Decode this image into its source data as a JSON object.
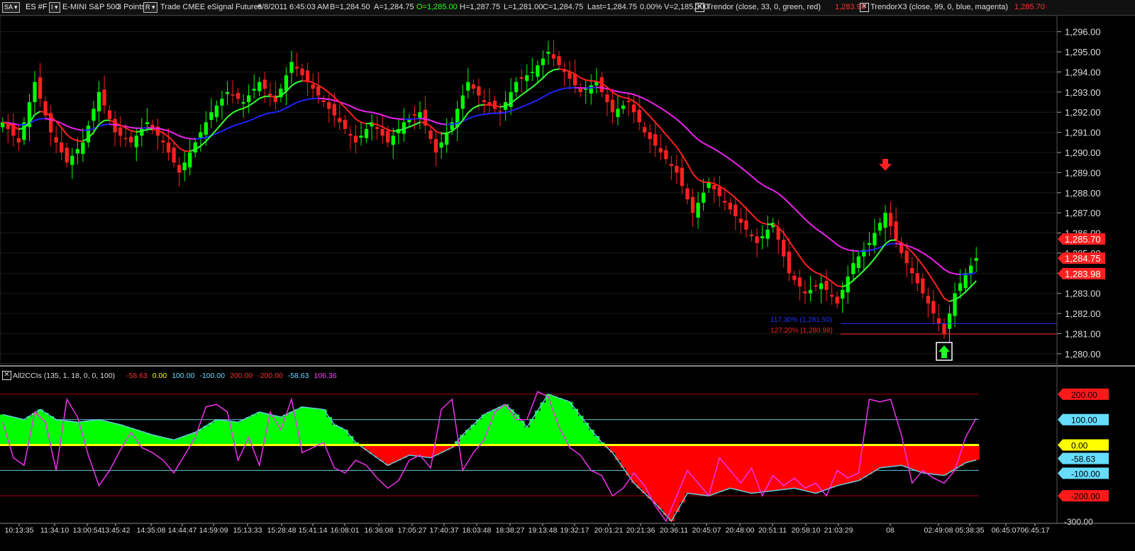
{
  "header": {
    "chart_button": "SA",
    "symbol": "ES #F",
    "interval_button": "I",
    "description": "E-MINI S&P 500",
    "points": "3 Points",
    "r_button": "R",
    "feed": "Trade  CMEE  eSignal  Futures",
    "date": "6/8/2011",
    "time": "6:45:03 AM",
    "bid": "B=1,284.50",
    "ask": "A=1,284.75",
    "open": "O=1,285.00",
    "high": "H=1,287.75",
    "low": "L=1,281.00",
    "close": "C=1,284.75",
    "last": "Last=1,284.75",
    "change": "0.00%",
    "volume": "V=2,185,300",
    "study1": "Trendor (close, 33, 0, green, red)",
    "study1_value": "1,283.98",
    "study2": "TrendorX3 (close, 99, 0, blue, magenta)",
    "study2_value": "1,285.70"
  },
  "lower_header": {
    "study": "All2CCIs (135, 1, 18, 0, 0, 100)",
    "values": [
      "-58.63",
      "0.00",
      "100.00",
      "-100.00",
      "200.00",
      "-200.00",
      "-58.63",
      "106.36"
    ],
    "value_colors": [
      "#ff3030",
      "#ffff00",
      "#66ddff",
      "#66ddff",
      "#ff3030",
      "#ff3030",
      "#66ddff",
      "#ff44ff"
    ]
  },
  "price_labels": {
    "p1": {
      "text": "1,285.70",
      "value": 1285.7,
      "color": "#ff2020"
    },
    "p2": {
      "text": "1,284.75",
      "value": 1284.75,
      "color": "#ff2020"
    },
    "p3": {
      "text": "1,283.98",
      "value": 1283.98,
      "color": "#ff2020"
    }
  },
  "fib_levels": [
    {
      "label": "117.30% (1,281.50)",
      "value": 1281.5,
      "color": "#2233ff"
    },
    {
      "label": "127.20% (1,280.98)",
      "value": 1280.98,
      "color": "#ff2020"
    }
  ],
  "signals": [
    {
      "name": "sell-arrow",
      "direction": "down",
      "bar": 165,
      "color": "#ff2020"
    },
    {
      "name": "buy-arrow",
      "direction": "up",
      "bar": 176,
      "color": "#22ff22"
    }
  ],
  "osc_labels": [
    {
      "text": "200.00",
      "value": 200,
      "bg": "#ff1a1a",
      "fg": "#000"
    },
    {
      "text": "100.00",
      "value": 100,
      "bg": "#66ddff",
      "fg": "#000"
    },
    {
      "text": "0.00",
      "value": 0,
      "bg": "#ffff00",
      "fg": "#000"
    },
    {
      "text": "-58.63",
      "value": -58.63,
      "bg": "#66ddff",
      "fg": "#000"
    },
    {
      "text": "-100.00",
      "value": -100,
      "bg": "#66ddff",
      "fg": "#000"
    },
    {
      "text": "-200.00",
      "value": -200,
      "bg": "#ff1a1a",
      "fg": "#000"
    }
  ],
  "colors": {
    "background": "#000000",
    "up_candle": "#00ff00",
    "down_candle": "#ff2020",
    "trendor_fast_up": "#33ff33",
    "trendor_fast_down": "#ff2020",
    "trendor_slow_up": "#2222ff",
    "trendor_slow_down": "#ee22ee",
    "cci_positive": "#00ff00",
    "cci_negative": "#ff0000",
    "cci_line": "#ee33ee",
    "cci_outline": "#66ccdd",
    "zero_line": "#ffff00"
  },
  "chart_data": [
    {
      "type": "candlestick",
      "title": "E-MINI S&P 500 (ES #F) 3 Points",
      "ylim": [
        1279.5,
        1296.8
      ],
      "y_ticks": [
        1280,
        1281,
        1282,
        1283,
        1284,
        1285,
        1286,
        1287,
        1288,
        1289,
        1290,
        1291,
        1292,
        1293,
        1294,
        1295,
        1296
      ],
      "x_ticks": [
        "10:13:35",
        "11:34:10",
        "13:00:54",
        "13:45:42",
        "14:35:08",
        "14:44:47",
        "14:59:09",
        "15:13:33",
        "15:28:48",
        "15:41:14",
        "16:08:01",
        "16:36:08",
        "17:05:27",
        "17:40:37",
        "18:03:48",
        "18:38:27",
        "19:13:48",
        "19:32:17",
        "20:01:21",
        "20:21:36",
        "20:36:11",
        "20:45:07",
        "20:48:00",
        "20:51:11",
        "20:58:10",
        "21:03:29",
        "08",
        "02:49:08",
        "05:38:35",
        "06:45:07",
        "06:45:17"
      ],
      "bar_count": 183,
      "close_anchors": [
        [
          0,
          1291.5
        ],
        [
          3,
          1290.5
        ],
        [
          6,
          1293.5
        ],
        [
          9,
          1291
        ],
        [
          12,
          1289.5
        ],
        [
          15,
          1290.5
        ],
        [
          18,
          1293
        ],
        [
          21,
          1291
        ],
        [
          24,
          1290.5
        ],
        [
          27,
          1291.5
        ],
        [
          30,
          1290.5
        ],
        [
          33,
          1289
        ],
        [
          36,
          1290.5
        ],
        [
          39,
          1292
        ],
        [
          42,
          1293
        ],
        [
          45,
          1292.5
        ],
        [
          48,
          1293.5
        ],
        [
          51,
          1292.5
        ],
        [
          54,
          1294.5
        ],
        [
          57,
          1293.5
        ],
        [
          60,
          1292.5
        ],
        [
          63,
          1291.5
        ],
        [
          66,
          1290.5
        ],
        [
          69,
          1291.5
        ],
        [
          72,
          1290.5
        ],
        [
          75,
          1291.5
        ],
        [
          78,
          1292
        ],
        [
          81,
          1290
        ],
        [
          84,
          1291.5
        ],
        [
          87,
          1293.5
        ],
        [
          90,
          1292.5
        ],
        [
          93,
          1292
        ],
        [
          96,
          1293.5
        ],
        [
          99,
          1294
        ],
        [
          102,
          1295
        ],
        [
          105,
          1294
        ],
        [
          108,
          1293
        ],
        [
          111,
          1293.5
        ],
        [
          114,
          1292
        ],
        [
          117,
          1292.5
        ],
        [
          120,
          1291
        ],
        [
          123,
          1290
        ],
        [
          126,
          1289
        ],
        [
          129,
          1287
        ],
        [
          132,
          1288.5
        ],
        [
          135,
          1287.5
        ],
        [
          138,
          1286.5
        ],
        [
          141,
          1285.5
        ],
        [
          144,
          1286.5
        ],
        [
          147,
          1284
        ],
        [
          150,
          1283
        ],
        [
          153,
          1283.5
        ],
        [
          156,
          1282.5
        ],
        [
          159,
          1284.5
        ],
        [
          162,
          1285.5
        ],
        [
          165,
          1287
        ],
        [
          168,
          1285
        ],
        [
          171,
          1283.5
        ],
        [
          174,
          1282
        ],
        [
          176,
          1281
        ],
        [
          178,
          1283
        ],
        [
          180,
          1284
        ],
        [
          182,
          1284.75
        ]
      ],
      "series": [
        {
          "name": "Trendor (close, 33)",
          "value": 1283.98
        },
        {
          "name": "TrendorX3 (close, 99)",
          "value": 1285.7
        }
      ]
    },
    {
      "type": "area",
      "title": "All2CCIs (135, 1, 18, 0, 0, 100)",
      "ylim": [
        -300,
        250
      ],
      "y_ticks": [
        200,
        100,
        0,
        -58.63,
        -100,
        -200,
        -300
      ],
      "cci_anchors": [
        [
          0,
          120
        ],
        [
          4,
          100
        ],
        [
          7,
          140
        ],
        [
          10,
          100
        ],
        [
          14,
          90
        ],
        [
          18,
          100
        ],
        [
          22,
          80
        ],
        [
          25,
          60
        ],
        [
          28,
          40
        ],
        [
          32,
          20
        ],
        [
          36,
          50
        ],
        [
          40,
          100
        ],
        [
          44,
          90
        ],
        [
          48,
          130
        ],
        [
          52,
          110
        ],
        [
          56,
          150
        ],
        [
          60,
          140
        ],
        [
          62,
          80
        ],
        [
          64,
          60
        ],
        [
          66,
          10
        ],
        [
          68,
          -20
        ],
        [
          72,
          -80
        ],
        [
          76,
          -40
        ],
        [
          80,
          -50
        ],
        [
          84,
          -10
        ],
        [
          86,
          40
        ],
        [
          90,
          120
        ],
        [
          94,
          160
        ],
        [
          96,
          120
        ],
        [
          98,
          70
        ],
        [
          102,
          200
        ],
        [
          106,
          170
        ],
        [
          110,
          60
        ],
        [
          112,
          10
        ],
        [
          114,
          -30
        ],
        [
          118,
          -150
        ],
        [
          122,
          -230
        ],
        [
          125,
          -300
        ],
        [
          128,
          -190
        ],
        [
          132,
          -200
        ],
        [
          136,
          -170
        ],
        [
          140,
          -190
        ],
        [
          144,
          -180
        ],
        [
          148,
          -170
        ],
        [
          152,
          -190
        ],
        [
          156,
          -160
        ],
        [
          160,
          -140
        ],
        [
          164,
          -90
        ],
        [
          168,
          -80
        ],
        [
          172,
          -110
        ],
        [
          176,
          -120
        ],
        [
          180,
          -70
        ],
        [
          182,
          -58.63
        ]
      ],
      "turbo_anchors": [
        [
          0,
          90
        ],
        [
          2,
          -50
        ],
        [
          4,
          -80
        ],
        [
          6,
          130
        ],
        [
          8,
          90
        ],
        [
          10,
          -100
        ],
        [
          12,
          180
        ],
        [
          14,
          110
        ],
        [
          16,
          -40
        ],
        [
          18,
          -160
        ],
        [
          20,
          -100
        ],
        [
          22,
          -20
        ],
        [
          24,
          50
        ],
        [
          26,
          -10
        ],
        [
          28,
          -30
        ],
        [
          30,
          -60
        ],
        [
          32,
          -110
        ],
        [
          34,
          -40
        ],
        [
          36,
          30
        ],
        [
          38,
          150
        ],
        [
          40,
          160
        ],
        [
          42,
          130
        ],
        [
          44,
          -60
        ],
        [
          46,
          30
        ],
        [
          48,
          -80
        ],
        [
          50,
          130
        ],
        [
          52,
          60
        ],
        [
          54,
          180
        ],
        [
          56,
          -30
        ],
        [
          58,
          -10
        ],
        [
          60,
          10
        ],
        [
          62,
          -90
        ],
        [
          64,
          -110
        ],
        [
          66,
          -60
        ],
        [
          68,
          -80
        ],
        [
          70,
          -130
        ],
        [
          72,
          -170
        ],
        [
          74,
          -140
        ],
        [
          76,
          -60
        ],
        [
          78,
          -40
        ],
        [
          80,
          -90
        ],
        [
          82,
          140
        ],
        [
          84,
          180
        ],
        [
          86,
          -100
        ],
        [
          88,
          -30
        ],
        [
          90,
          20
        ],
        [
          92,
          130
        ],
        [
          94,
          160
        ],
        [
          96,
          100
        ],
        [
          98,
          100
        ],
        [
          100,
          210
        ],
        [
          102,
          190
        ],
        [
          104,
          70
        ],
        [
          106,
          -10
        ],
        [
          108,
          -40
        ],
        [
          110,
          -100
        ],
        [
          112,
          -120
        ],
        [
          114,
          -200
        ],
        [
          116,
          -170
        ],
        [
          118,
          -110
        ],
        [
          120,
          -160
        ],
        [
          122,
          -240
        ],
        [
          124,
          -300
        ],
        [
          126,
          -200
        ],
        [
          128,
          -100
        ],
        [
          130,
          -150
        ],
        [
          132,
          -200
        ],
        [
          134,
          -50
        ],
        [
          136,
          -100
        ],
        [
          138,
          -150
        ],
        [
          140,
          -90
        ],
        [
          142,
          -200
        ],
        [
          144,
          -120
        ],
        [
          146,
          -160
        ],
        [
          148,
          -130
        ],
        [
          150,
          -170
        ],
        [
          152,
          -150
        ],
        [
          154,
          -200
        ],
        [
          156,
          -100
        ],
        [
          158,
          -130
        ],
        [
          160,
          -110
        ],
        [
          162,
          180
        ],
        [
          164,
          170
        ],
        [
          166,
          180
        ],
        [
          168,
          40
        ],
        [
          170,
          -150
        ],
        [
          172,
          -100
        ],
        [
          174,
          -130
        ],
        [
          176,
          -150
        ],
        [
          178,
          -100
        ],
        [
          180,
          30
        ],
        [
          182,
          106.36
        ]
      ]
    }
  ]
}
